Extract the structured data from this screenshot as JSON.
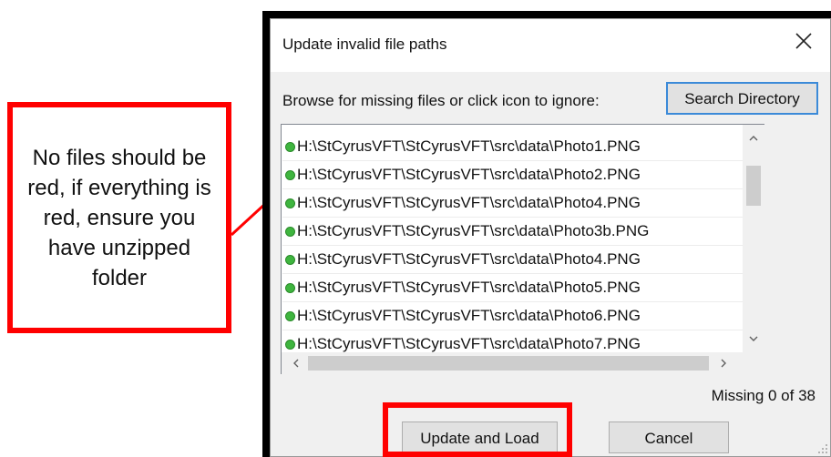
{
  "callout": {
    "text": "No files should be red, if everything is red, ensure you have unzipped folder"
  },
  "dialog": {
    "title": "Update invalid file paths",
    "browse_label": "Browse for missing files or click icon to ignore:",
    "search_button": "Search Directory",
    "files": [
      {
        "path": "H:\\StCyrusVFT\\StCyrusVFT\\src\\data\\Photo1.PNG",
        "status": "green"
      },
      {
        "path": "H:\\StCyrusVFT\\StCyrusVFT\\src\\data\\Photo2.PNG",
        "status": "green"
      },
      {
        "path": "H:\\StCyrusVFT\\StCyrusVFT\\src\\data\\Photo4.PNG",
        "status": "green"
      },
      {
        "path": "H:\\StCyrusVFT\\StCyrusVFT\\src\\data\\Photo3b.PNG",
        "status": "green"
      },
      {
        "path": "H:\\StCyrusVFT\\StCyrusVFT\\src\\data\\Photo4.PNG",
        "status": "green"
      },
      {
        "path": "H:\\StCyrusVFT\\StCyrusVFT\\src\\data\\Photo5.PNG",
        "status": "green"
      },
      {
        "path": "H:\\StCyrusVFT\\StCyrusVFT\\src\\data\\Photo6.PNG",
        "status": "green"
      },
      {
        "path": "H:\\StCyrusVFT\\StCyrusVFT\\src\\data\\Photo7.PNG",
        "status": "green"
      }
    ],
    "missing_status": "Missing 0 of 38",
    "update_button": "Update and Load",
    "cancel_button": "Cancel"
  },
  "colors": {
    "annotation_red": "#ff0000",
    "status_green": "#3fb53f",
    "button_focus_border": "#3b8ad8"
  },
  "icons": {
    "close": "close-icon",
    "scroll_up": "chevron-up-icon",
    "scroll_down": "chevron-down-icon",
    "scroll_left": "chevron-left-icon",
    "scroll_right": "chevron-right-icon",
    "status": "status-dot-icon",
    "resize": "resize-grip-icon"
  }
}
